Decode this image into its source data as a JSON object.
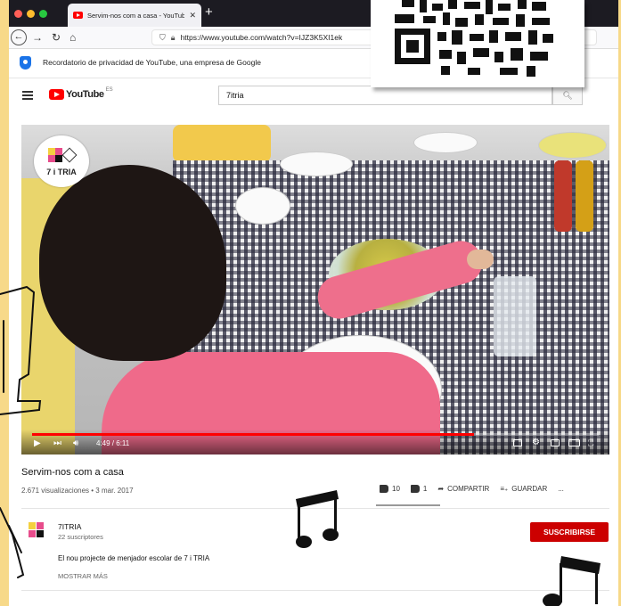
{
  "browser": {
    "tab_title": "Servim-nos com a casa - YouTube",
    "tab_close": "✕",
    "new_tab": "+",
    "url": "https://www.youtube.com/watch?v=IJZ3K5XI1ek",
    "back": "←",
    "forward": "→",
    "reload": "↻",
    "home": "⌂"
  },
  "banner": {
    "text": "Recordatorio de privacidad de YouTube, una empresa de Google"
  },
  "header": {
    "logo_text": "YouTube",
    "region": "ES",
    "search_value": "7itria"
  },
  "video": {
    "overlay_logo_text": "7 i TRIA",
    "time": "4:49 / 6:11",
    "progress": 0.78,
    "title": "Servim-nos com a casa",
    "views": "2.671 visualizaciones • 3 mar. 2017"
  },
  "actions": {
    "likes": "10",
    "dislikes": "1",
    "share": "COMPARTIR",
    "save": "GUARDAR",
    "more": "..."
  },
  "channel": {
    "name": "7ITRIA",
    "subscribers": "22 suscriptores",
    "subscribe_label": "SUSCRIBIRSE",
    "description": "El nou projecte de menjador escolar de 7 i TRIA",
    "show_more": "MOSTRAR MÁS"
  },
  "colors": {
    "page_bg": "#f7d989",
    "youtube_red": "#ff0000",
    "subscribe_red": "#cc0000"
  }
}
